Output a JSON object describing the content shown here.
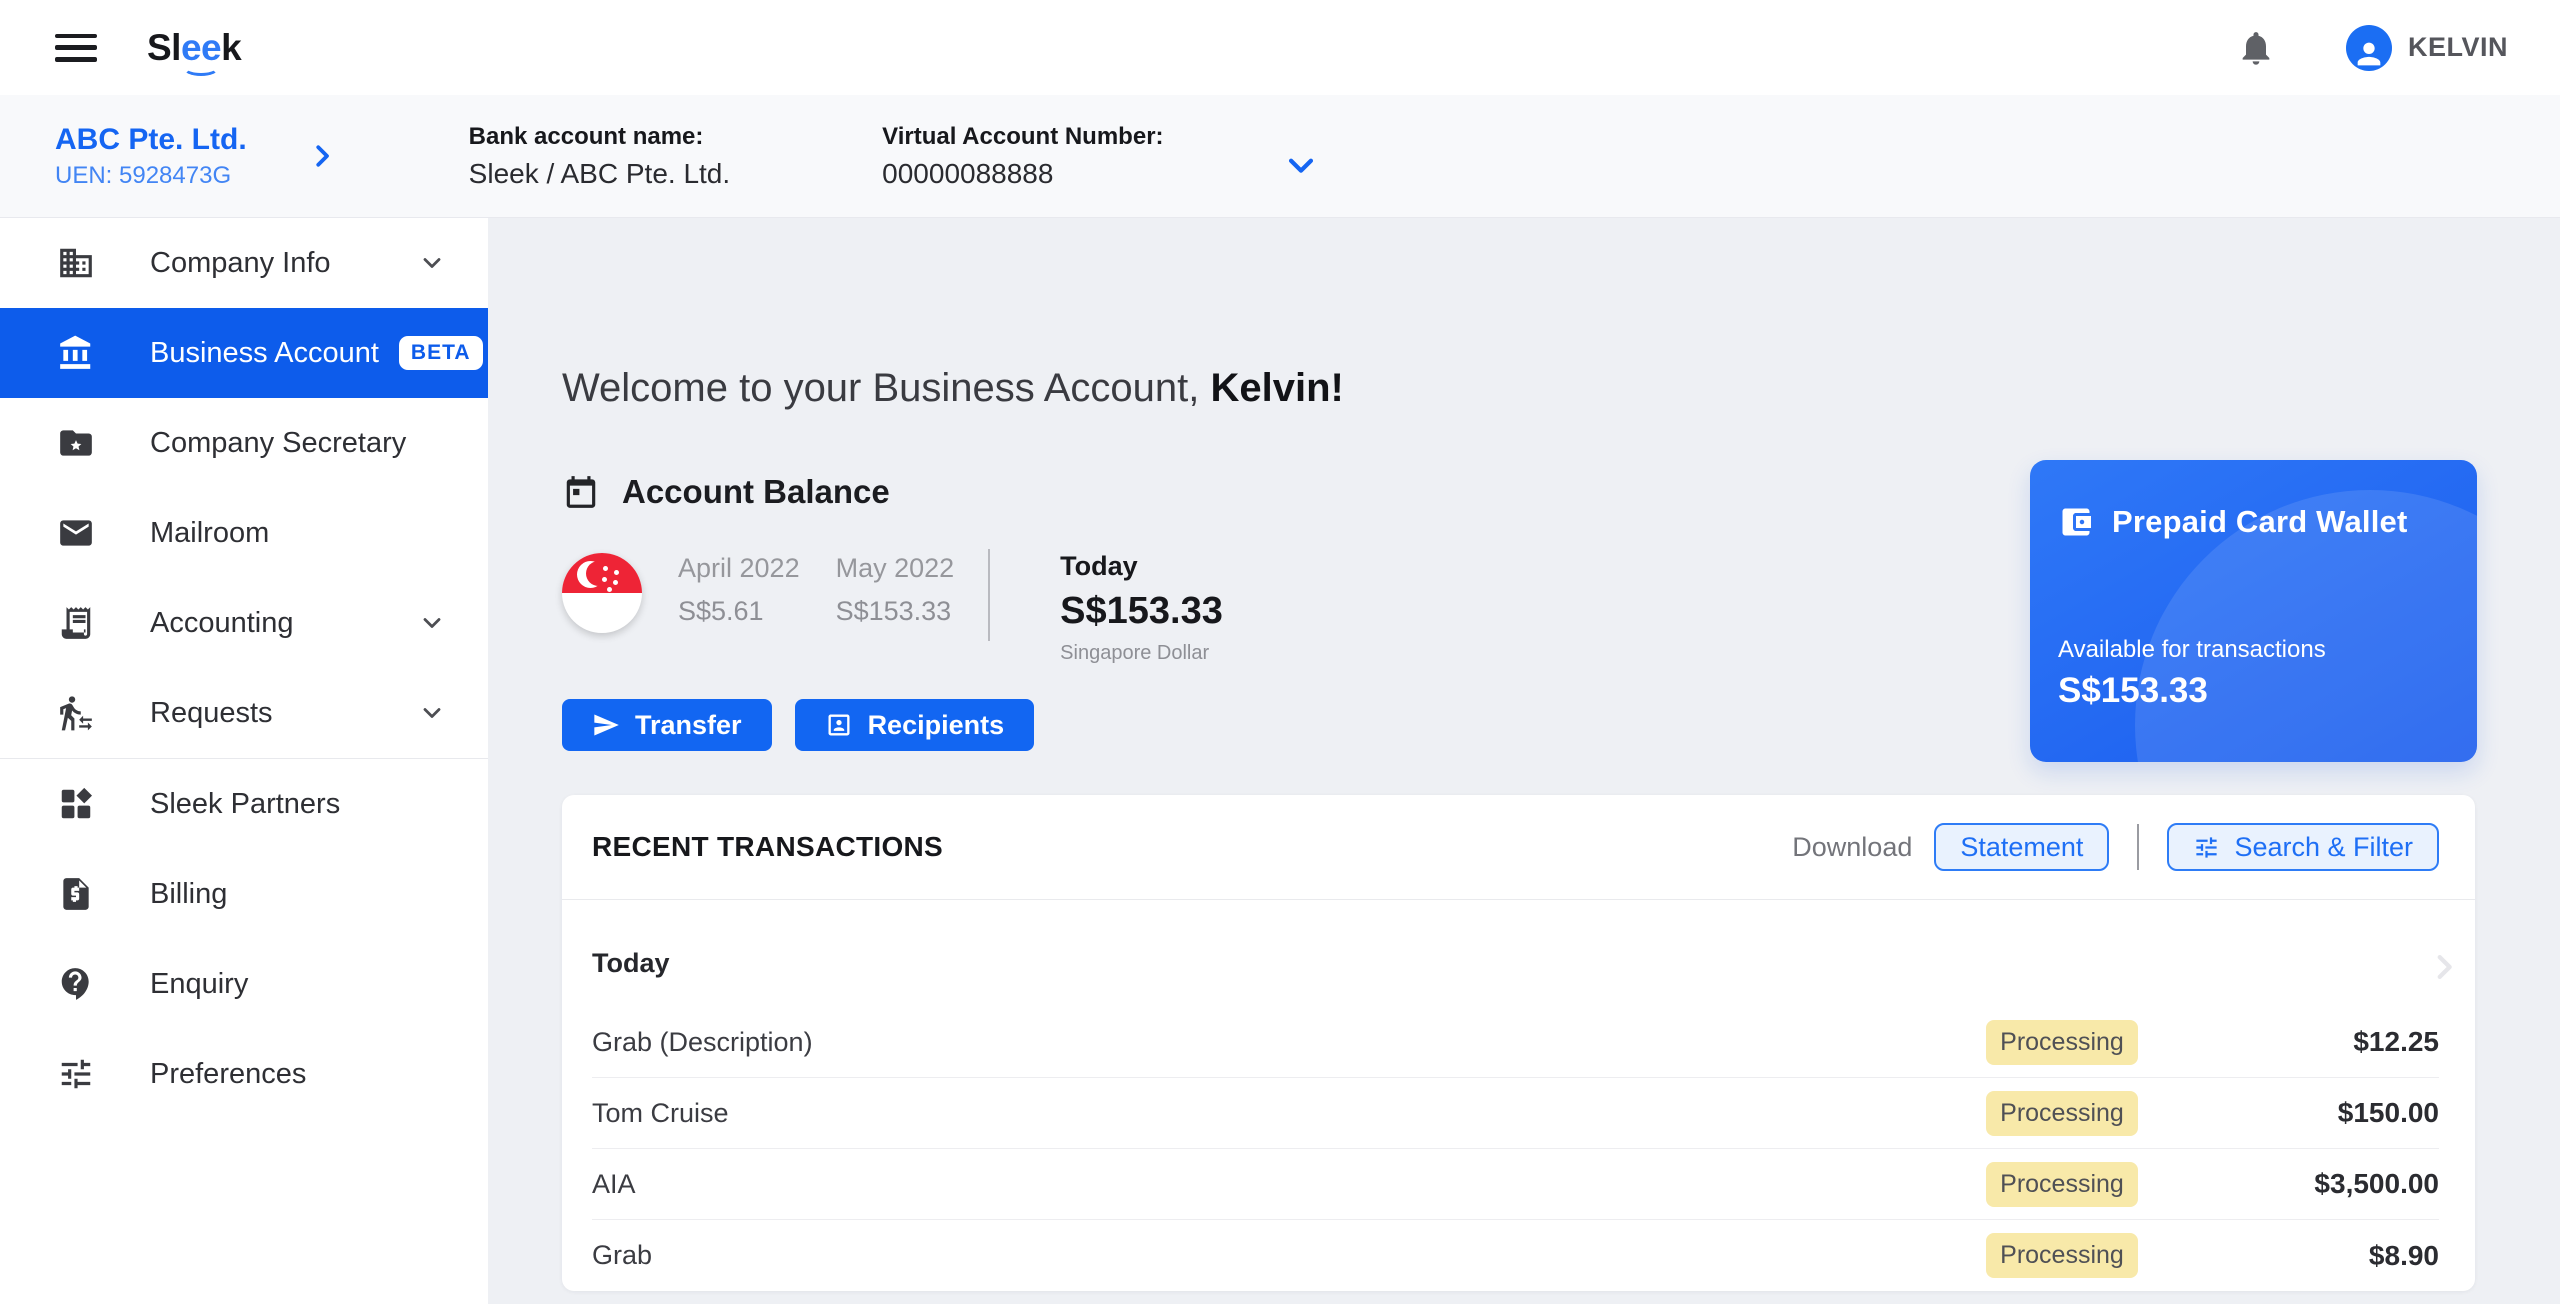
{
  "colors": {
    "primary_blue": "#1266f2",
    "sidebar_active_blue": "#0d5ceb",
    "outline_button_blue": "#1e6ff5",
    "status_badge_yellow": "#f8e9a9",
    "prepaid_card_blue": "#1a5cee",
    "flag_red": "#ee2436"
  },
  "topbar": {
    "logo_s1": "Sl",
    "logo_ee": "ee",
    "logo_k": "k",
    "user_name": "KELVIN"
  },
  "subheader": {
    "company_name": "ABC Pte. Ltd.",
    "company_uen": "UEN: 5928473G",
    "bank_label": "Bank account name:",
    "bank_value": "Sleek / ABC Pte. Ltd.",
    "van_label": "Virtual Account Number:",
    "van_value": "00000088888"
  },
  "sidebar": {
    "items": [
      {
        "label": "Company Info",
        "icon": "building-icon",
        "expandable": true
      },
      {
        "label": "Business Account",
        "icon": "bank-icon",
        "badge": "BETA",
        "active": true
      },
      {
        "label": "Company Secretary",
        "icon": "folder-star-icon"
      },
      {
        "label": "Mailroom",
        "icon": "envelope-icon"
      },
      {
        "label": "Accounting",
        "icon": "receipt-icon",
        "expandable": true
      },
      {
        "label": "Requests",
        "icon": "person-transfer-icon",
        "expandable": true
      },
      {
        "label": "Sleek Partners",
        "icon": "grid-shapes-icon"
      },
      {
        "label": "Billing",
        "icon": "invoice-icon"
      },
      {
        "label": "Enquiry",
        "icon": "question-bubble-icon"
      },
      {
        "label": "Preferences",
        "icon": "sliders-icon"
      }
    ]
  },
  "main": {
    "welcome_prefix": "Welcome to your Business Account, ",
    "welcome_name": "Kelvin!",
    "balance": {
      "section_title": "Account Balance",
      "periods": [
        {
          "label": "April 2022",
          "value": "S$5.61"
        },
        {
          "label": "May 2022",
          "value": "S$153.33"
        }
      ],
      "today_label": "Today",
      "today_value": "S$153.33",
      "currency": "Singapore Dollar"
    },
    "actions": {
      "transfer": "Transfer",
      "recipients": "Recipients"
    },
    "prepaid_card": {
      "title": "Prepaid Card Wallet",
      "subtitle": "Available for transactions",
      "amount": "S$153.33"
    },
    "transactions": {
      "title": "RECENT TRANSACTIONS",
      "download_label": "Download",
      "statement_button": "Statement",
      "filter_button": "Search & Filter",
      "group_title": "Today",
      "rows": [
        {
          "name": "Grab (Description)",
          "status": "Processing",
          "amount": "$12.25"
        },
        {
          "name": "Tom Cruise",
          "status": "Processing",
          "amount": "$150.00"
        },
        {
          "name": "AIA",
          "status": "Processing",
          "amount": "$3,500.00"
        },
        {
          "name": "Grab",
          "status": "Processing",
          "amount": "$8.90"
        }
      ]
    }
  }
}
